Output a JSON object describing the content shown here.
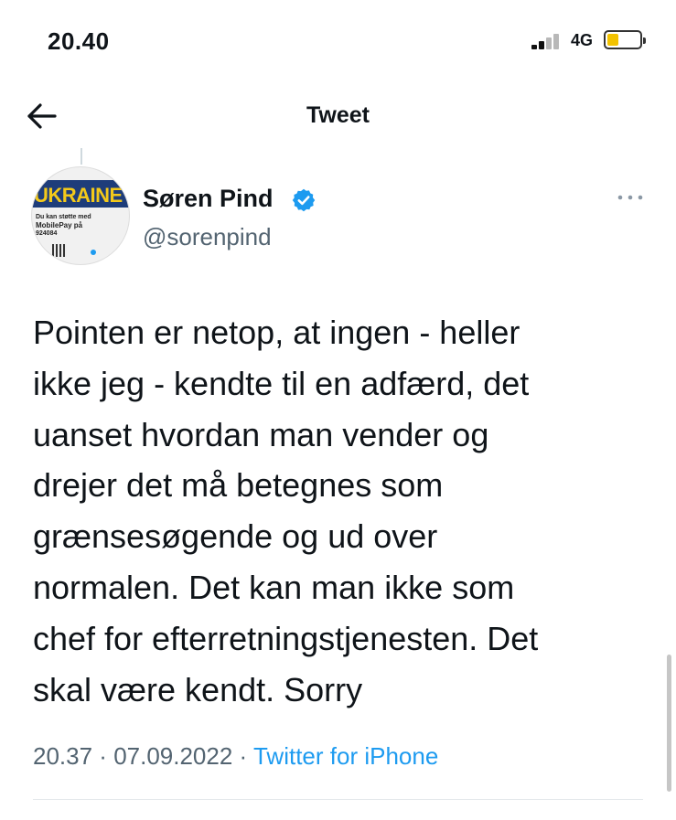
{
  "status_bar": {
    "time": "20.40",
    "network": "4G",
    "signal_bars_active": 2,
    "signal_bars_total": 4,
    "battery_level": 0.35,
    "battery_color": "#f2c200"
  },
  "nav": {
    "title": "Tweet",
    "back_icon": "arrow-left-icon"
  },
  "tweet": {
    "author": {
      "name": "Søren Pind",
      "handle": "@sorenpind",
      "verified": true,
      "avatar_text": {
        "banner": "UKRAINE",
        "line1": "Du kan støtte med",
        "line2": "MobilePay på",
        "line3": "924084"
      }
    },
    "text_lines": [
      "Pointen er netop, at ingen - heller",
      "ikke jeg - kendte til en adfærd, det",
      "uanset hvordan man vender og",
      "drejer det må betegnes som",
      "grænsesøgende og ud over",
      "normalen. Det kan man ikke som",
      "chef for efterretningstjenesten. Det",
      "skal være kendt. Sorry"
    ],
    "time": "20.37",
    "date": "07.09.2022",
    "separator": " · ",
    "source": "Twitter for iPhone"
  },
  "colors": {
    "accent": "#1d9bf0",
    "secondary_text": "#536471",
    "primary_text": "#0f1419"
  }
}
